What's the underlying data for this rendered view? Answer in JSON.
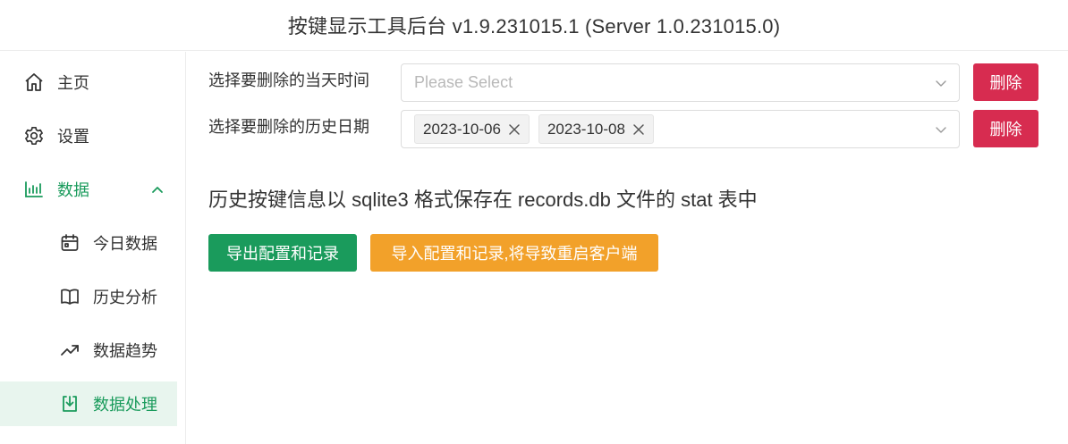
{
  "window": {
    "title": "按键显示工具后台 v1.9.231015.1 (Server 1.0.231015.0)"
  },
  "sidebar": {
    "items": [
      {
        "label": "主页",
        "icon": "home-icon"
      },
      {
        "label": "设置",
        "icon": "gear-icon"
      },
      {
        "label": "数据",
        "icon": "bar-chart-icon",
        "expanded": true
      },
      {
        "label": "今日数据",
        "icon": "calendar-icon"
      },
      {
        "label": "历史分析",
        "icon": "book-icon"
      },
      {
        "label": "数据趋势",
        "icon": "trend-icon"
      },
      {
        "label": "数据处理",
        "icon": "download-icon",
        "active": true
      }
    ]
  },
  "main": {
    "delete_today": {
      "label": "选择要删除的当天时间",
      "placeholder": "Please Select",
      "button": "删除"
    },
    "delete_history": {
      "label": "选择要删除的历史日期",
      "selected": [
        "2023-10-06",
        "2023-10-08"
      ],
      "button": "删除"
    },
    "info": "历史按键信息以 sqlite3 格式保存在 records.db 文件的 stat 表中",
    "export_button": "导出配置和记录",
    "import_button": "导入配置和记录,将导致重启客户端"
  },
  "colors": {
    "accent": "#1a9b5c",
    "danger": "#d72c50",
    "warning": "#f2a12a",
    "active_bg": "#e8f5ee"
  }
}
